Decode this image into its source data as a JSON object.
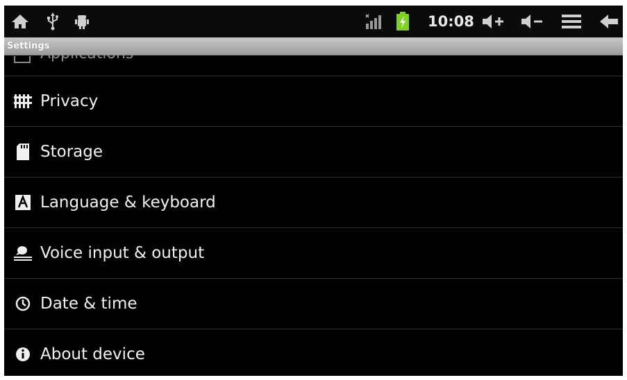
{
  "status_bar": {
    "time": "10:08",
    "left_icons": [
      "home-icon",
      "usb-icon",
      "android-debug-icon"
    ],
    "right_icons": [
      "signal-icon",
      "battery-charging-icon",
      "volume-up-icon",
      "volume-down-icon",
      "menu-icon",
      "back-icon"
    ]
  },
  "title_bar": {
    "title": "Settings"
  },
  "settings_list": {
    "partial_item": {
      "label": "Applications"
    },
    "items": [
      {
        "label": "Privacy",
        "icon": "privacy-icon"
      },
      {
        "label": "Storage",
        "icon": "sd-card-icon"
      },
      {
        "label": "Language & keyboard",
        "icon": "language-icon"
      },
      {
        "label": "Voice input & output",
        "icon": "voice-icon"
      },
      {
        "label": "Date & time",
        "icon": "clock-icon"
      },
      {
        "label": "About device",
        "icon": "info-icon"
      }
    ]
  },
  "colors": {
    "background": "#000000",
    "title_bar": "#b4b4b4",
    "battery_charge": "#7fd422",
    "text": "#f2f2f2"
  }
}
